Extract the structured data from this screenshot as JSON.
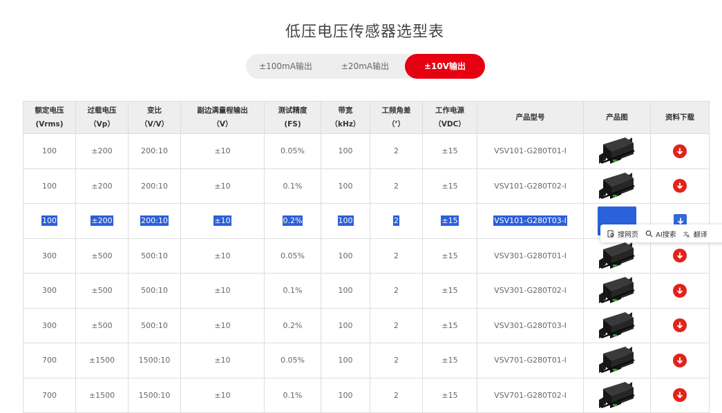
{
  "page_title": "低压电压传感器选型表",
  "tabs": [
    {
      "label": "±100mA输出",
      "active": false
    },
    {
      "label": "±20mA输出",
      "active": false
    },
    {
      "label": "±10V输出",
      "active": true
    }
  ],
  "table": {
    "headers": [
      [
        "额定电压",
        "(Vrms)"
      ],
      [
        "过载电压",
        "（Vp）"
      ],
      [
        "变比",
        "（V/V）"
      ],
      [
        "副边满量程输出",
        "（V）"
      ],
      [
        "测试精度",
        "(FS)"
      ],
      [
        "带宽",
        "（kHz）"
      ],
      [
        "工频角差",
        "（’）"
      ],
      [
        "工作电源",
        "（VDC）"
      ],
      [
        "产品型号",
        ""
      ],
      [
        "产品图",
        ""
      ],
      [
        "资料下载",
        ""
      ]
    ],
    "rows": [
      [
        "100",
        "±200",
        "200:10",
        "±10",
        "0.05%",
        "100",
        "2",
        "±15",
        "VSV101-G280T01-I"
      ],
      [
        "100",
        "±200",
        "200:10",
        "±10",
        "0.1%",
        "100",
        "2",
        "±15",
        "VSV101-G280T02-I"
      ],
      [
        "100",
        "±200",
        "200:10",
        "±10",
        "0.2%",
        "100",
        "2",
        "±15",
        "VSV101-G280T03-I"
      ],
      [
        "300",
        "±500",
        "500:10",
        "±10",
        "0.05%",
        "100",
        "2",
        "±15",
        "VSV301-G280T01-I"
      ],
      [
        "300",
        "±500",
        "500:10",
        "±10",
        "0.1%",
        "100",
        "2",
        "±15",
        "VSV301-G280T02-I"
      ],
      [
        "300",
        "±500",
        "500:10",
        "±10",
        "0.2%",
        "100",
        "2",
        "±15",
        "VSV301-G280T03-I"
      ],
      [
        "700",
        "±1500",
        "1500:10",
        "±10",
        "0.05%",
        "100",
        "2",
        "±15",
        "VSV701-G280T01-I"
      ],
      [
        "700",
        "±1500",
        "1500:10",
        "±10",
        "0.1%",
        "100",
        "2",
        "±15",
        "VSV701-G280T02-I"
      ]
    ],
    "selected_row_index": 2
  },
  "popover": {
    "items": [
      {
        "icon": "search-page-icon",
        "label": "搜网页"
      },
      {
        "icon": "search-icon",
        "label": "AI搜索"
      },
      {
        "icon": "translate-icon",
        "label": "翻译"
      }
    ]
  },
  "colors": {
    "accent": "#e60012",
    "selection": "#2b5fd9",
    "download_button": "#e2231a"
  }
}
